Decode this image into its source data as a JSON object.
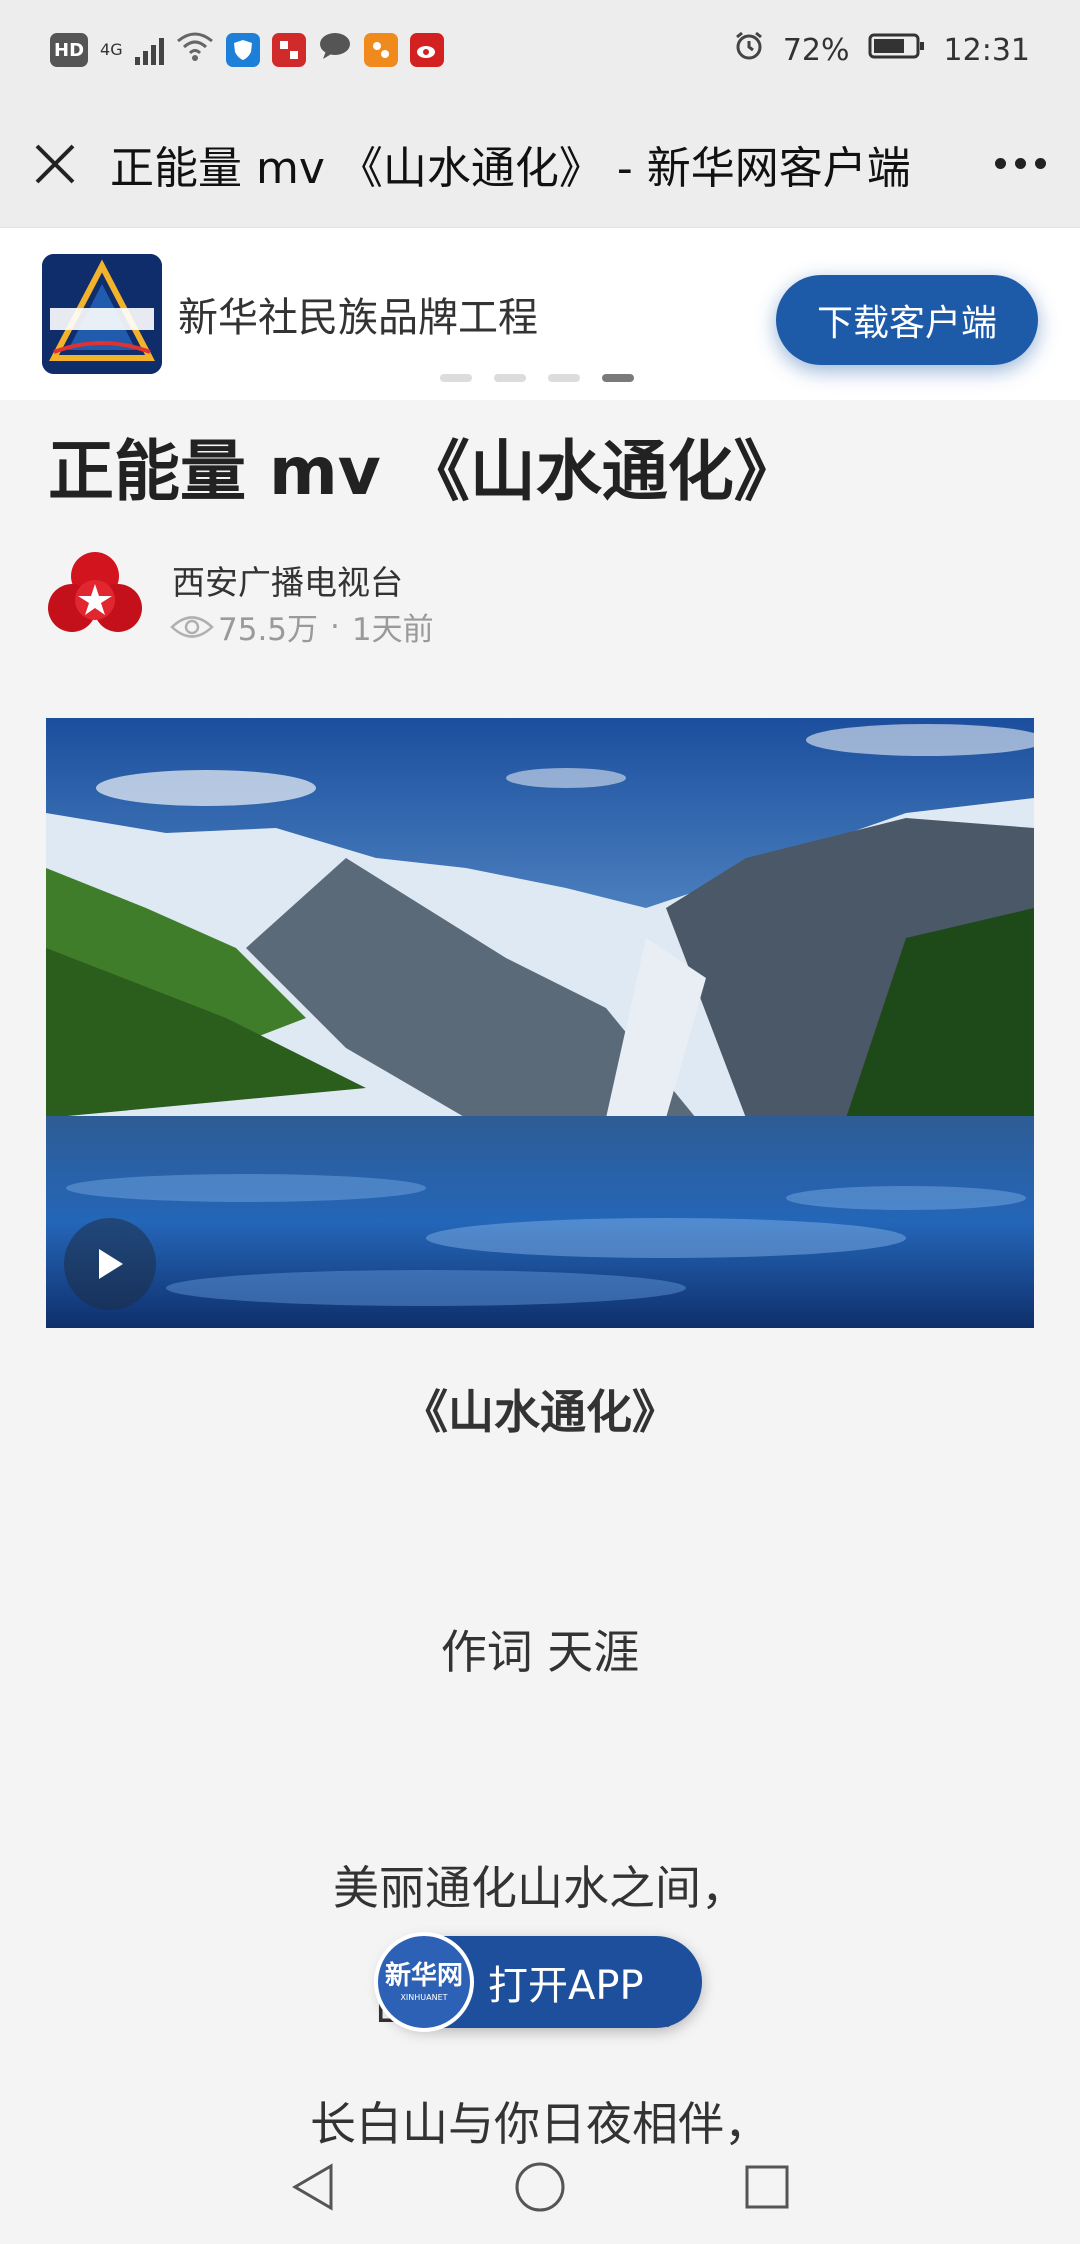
{
  "status_bar": {
    "hd": "HD",
    "network": "4G",
    "alarm_icon": "alarm-icon",
    "battery": "72%",
    "time": "12:31"
  },
  "title_bar": {
    "title": "正能量 mv 《山水通化》 - 新华网客户端",
    "close_icon": "close-icon",
    "more_icon": "more-icon"
  },
  "banner": {
    "text": "新华社民族品牌工程",
    "download_label": "下载客户端",
    "slides": 4,
    "active_slide": 4
  },
  "article": {
    "title": "正能量 mv 《山水通化》",
    "author": "西安广播电视台",
    "views": "75.5万",
    "separator": "·",
    "time": "1天前"
  },
  "body": {
    "song_title": "《山水通化》",
    "credit": "作词 天涯",
    "line1": "美丽通化山水之间，",
    "line2_prefix": "山",
    "line2_suffix": "，",
    "line3": "长白山与你日夜相伴，"
  },
  "open_app": {
    "logo_text": "新华网",
    "logo_subtext": "XINHUANET",
    "label": "打开APP"
  },
  "colors": {
    "accent": "#1d5aa8",
    "background": "#f4f4f4"
  }
}
